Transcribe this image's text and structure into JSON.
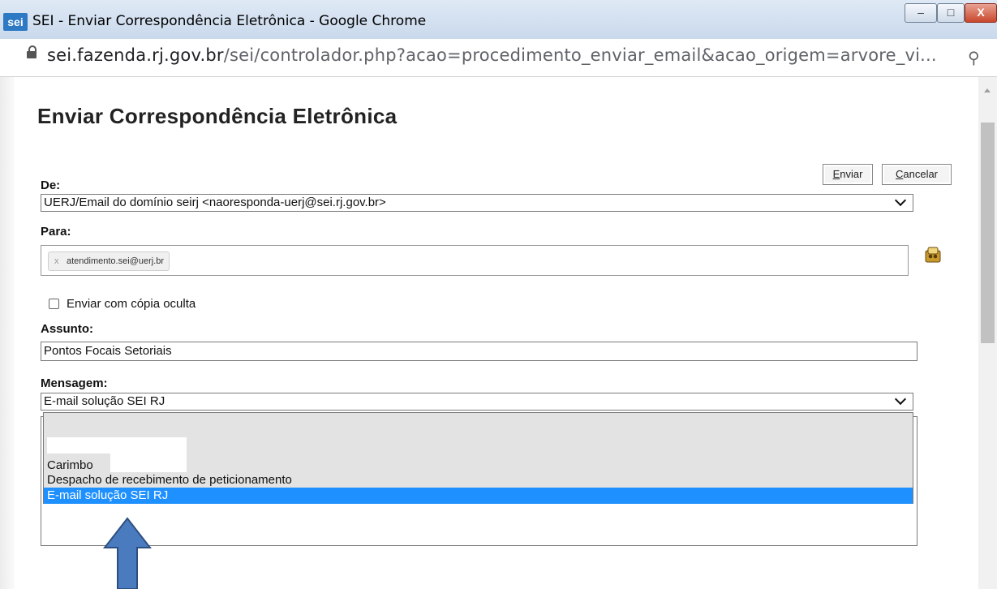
{
  "window": {
    "logo": "sei",
    "title": "SEI - Enviar Correspondência Eletrônica - Google Chrome",
    "controls": {
      "minimize": "–",
      "maximize": "□",
      "close": "X"
    }
  },
  "address_bar": {
    "url_host": "sei.fazenda.rj.gov.br",
    "url_rest": "/sei/controlador.php?acao=procedimento_enviar_email&acao_origem=arvore_vi...",
    "zoom_icon": "⚲"
  },
  "page": {
    "title": "Enviar Correspondência Eletrônica",
    "buttons": {
      "enviar": "Enviar",
      "cancelar": "Cancelar"
    },
    "de": {
      "label": "De:",
      "value": "UERJ/Email do domínio seirj <naoresponda-uerj@sei.rj.gov.br>"
    },
    "para": {
      "label": "Para:",
      "chips": [
        "atendimento.sei@uerj.br"
      ],
      "chip_remove": "x"
    },
    "bcc": {
      "label": "Enviar com cópia oculta",
      "checked": false
    },
    "assunto": {
      "label": "Assunto:",
      "value": "Pontos Focais Setoriais"
    },
    "mensagem": {
      "label": "Mensagem:",
      "value": "E-mail solução SEI RJ",
      "options": [
        "",
        "Carimbo",
        "Despacho de recebimento de peticionamento",
        "E-mail solução SEI RJ"
      ],
      "selected_index": 3
    }
  },
  "colors": {
    "selected_option": "#1e90ff",
    "annotation_arrow": "#4a7bbf",
    "title_bar": "#c9d9ec"
  },
  "icons": [
    "lock-icon",
    "zoom-icon",
    "contacts-icon",
    "chevron-down-icon",
    "remove-chip-icon",
    "arrow-up-annotation"
  ]
}
